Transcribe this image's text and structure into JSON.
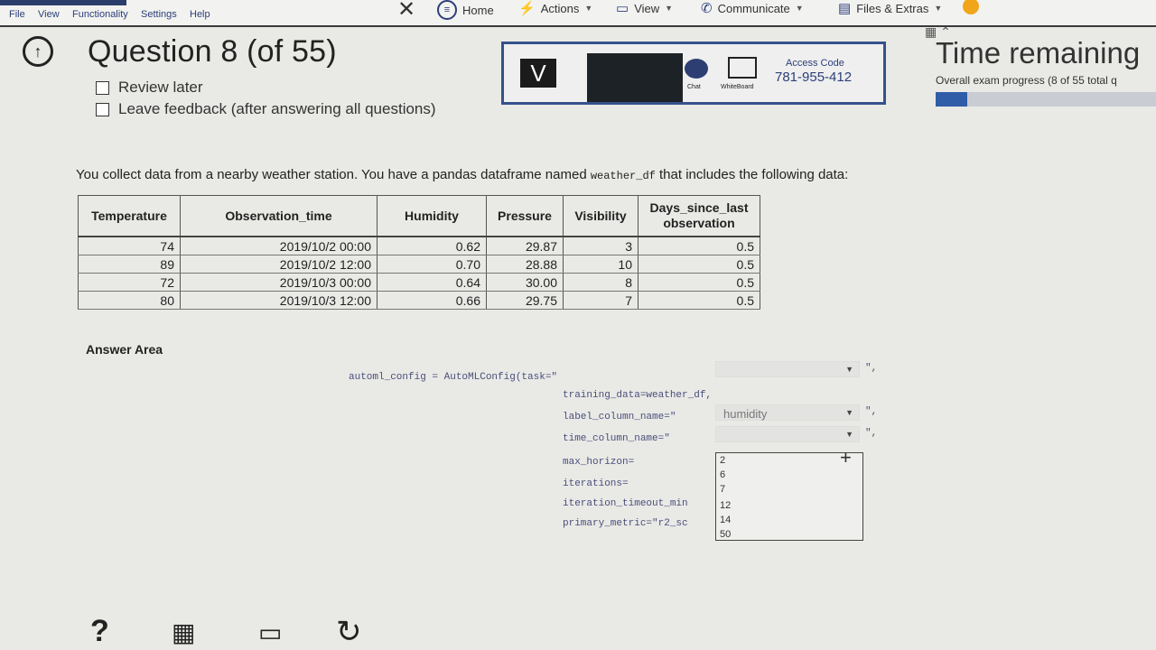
{
  "menu": {
    "file": "File",
    "view": "View",
    "functionality": "Functionality",
    "settings": "Settings",
    "help": "Help"
  },
  "toolbar": {
    "home": "Home",
    "actions": "Actions",
    "view": "View",
    "communicate": "Communicate",
    "files": "Files & Extras"
  },
  "question": {
    "title": "Question 8 (of 55)",
    "review_later": "Review later",
    "leave_feedback": "Leave feedback (after answering all questions)"
  },
  "proctor": {
    "logo": "V",
    "chat_label": "Chat",
    "whiteboard_label": "WhiteBoard",
    "access_code_label": "Access Code",
    "access_code": "781-955-412"
  },
  "status": {
    "time_remaining": "Time remaining",
    "progress_text": "Overall exam progress (8 of 55 total q",
    "progress_fraction": 0.145
  },
  "intro": {
    "before": "You collect data from a nearby weather station. You have a pandas dataframe named ",
    "code": "weather_df",
    "after": " that includes the following data:"
  },
  "table": {
    "headers": [
      "Temperature",
      "Observation_time",
      "Humidity",
      "Pressure",
      "Visibility",
      "Days_since_last observation"
    ],
    "rows": [
      [
        "74",
        "2019/10/2 00:00",
        "0.62",
        "29.87",
        "3",
        "0.5"
      ],
      [
        "89",
        "2019/10/2 12:00",
        "0.70",
        "28.88",
        "10",
        "0.5"
      ],
      [
        "72",
        "2019/10/3 00:00",
        "0.64",
        "30.00",
        "8",
        "0.5"
      ],
      [
        "80",
        "2019/10/3 12:00",
        "0.66",
        "29.75",
        "7",
        "0.5"
      ]
    ]
  },
  "answer": {
    "label": "Answer Area",
    "line1": "automl_config = AutoMLConfig(task=\"",
    "suffix1": "\",",
    "line2": "training_data=weather_df,",
    "line3": "label_column_name=\"",
    "label_value": "humidity",
    "suffix3": "\",",
    "line4": "time_column_name=\"",
    "suffix4": "\",",
    "line5": "max_horizon=",
    "line6": "iterations=",
    "line7": "iteration_timeout_min",
    "line8": "primary_metric=\"r2_sc",
    "options": [
      "2",
      "6",
      "7",
      "12",
      "14",
      "50"
    ]
  }
}
